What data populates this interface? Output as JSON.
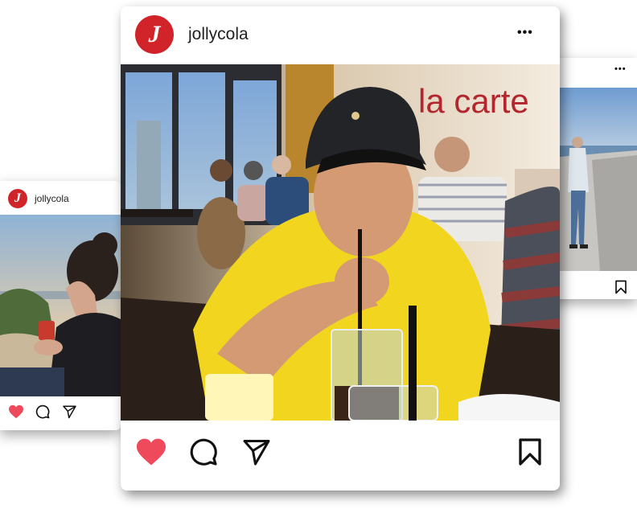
{
  "brand": {
    "avatar_letter": "J",
    "accent_color": "#d1232a",
    "like_color": "#ef4a5c"
  },
  "left_post": {
    "username": "jollycola",
    "liked": true,
    "icons": [
      "heart-filled-icon",
      "comment-icon",
      "share-icon"
    ]
  },
  "main_post": {
    "username": "jollycola",
    "more_label": "•••",
    "sign_text": "la carte",
    "liked": true,
    "icons": [
      "heart-filled-icon",
      "comment-icon",
      "share-icon",
      "bookmark-icon"
    ]
  },
  "right_post": {
    "more_label": "•••",
    "icons": [
      "bookmark-icon"
    ]
  }
}
